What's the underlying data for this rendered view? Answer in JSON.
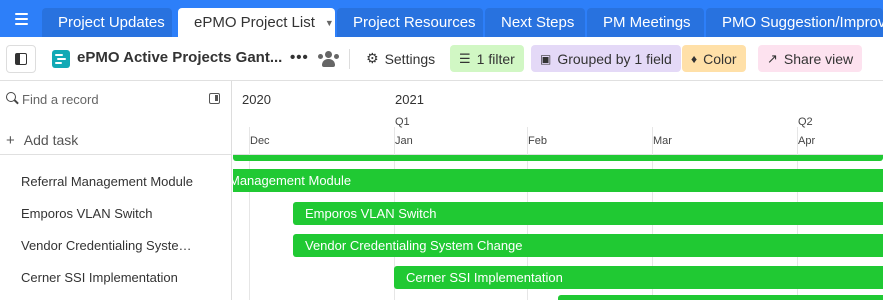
{
  "tabs": [
    {
      "label": "Project Updates",
      "active": false
    },
    {
      "label": "ePMO Project List",
      "active": true
    },
    {
      "label": "Project Resources",
      "active": false
    },
    {
      "label": "Next Steps",
      "active": false
    },
    {
      "label": "PM Meetings",
      "active": false
    },
    {
      "label": "PMO Suggestion/Improve",
      "active": false
    }
  ],
  "toolbar": {
    "view_title": "ePMO Active Projects Gant...",
    "settings_label": "Settings",
    "filter_label": "1 filter",
    "group_label": "Grouped by 1 field",
    "color_label": "Color",
    "share_label": "Share view"
  },
  "left_panel": {
    "find_placeholder": "Find a record",
    "add_task_label": "Add task",
    "records": [
      "Referral Management Module",
      "Emporos VLAN Switch",
      "Vendor Credentialing System Change",
      "Cerner SSI Implementation"
    ]
  },
  "timeline": {
    "years": [
      "2020",
      "2021"
    ],
    "quarters": [
      "Q1",
      "Q2"
    ],
    "months": [
      "Dec",
      "Jan",
      "Feb",
      "Mar",
      "Apr"
    ],
    "bars": [
      {
        "label": ""
      },
      {
        "label": "Management Module"
      },
      {
        "label": "Emporos VLAN Switch"
      },
      {
        "label": "Vendor Credentialing System Change"
      },
      {
        "label": "Cerner SSI Implementation"
      },
      {
        "label": ""
      }
    ]
  },
  "colors": {
    "tabbar": "#2d7ff9",
    "bar": "#20c933",
    "gantt_icon": "#11a9b5",
    "filter_bg": "#d1f7c4",
    "group_bg": "#e4d9f7",
    "color_bg": "#ffe0a8",
    "share_bg": "#fde2ef"
  },
  "icons": [
    "menu-icon",
    "caret-down-icon",
    "sidebar-toggle-icon",
    "gantt-view-icon",
    "more-icon",
    "people-icon",
    "gear-icon",
    "filter-icon",
    "group-icon",
    "paint-bucket-icon",
    "share-icon",
    "search-icon",
    "collapse-panel-icon",
    "plus-icon"
  ]
}
